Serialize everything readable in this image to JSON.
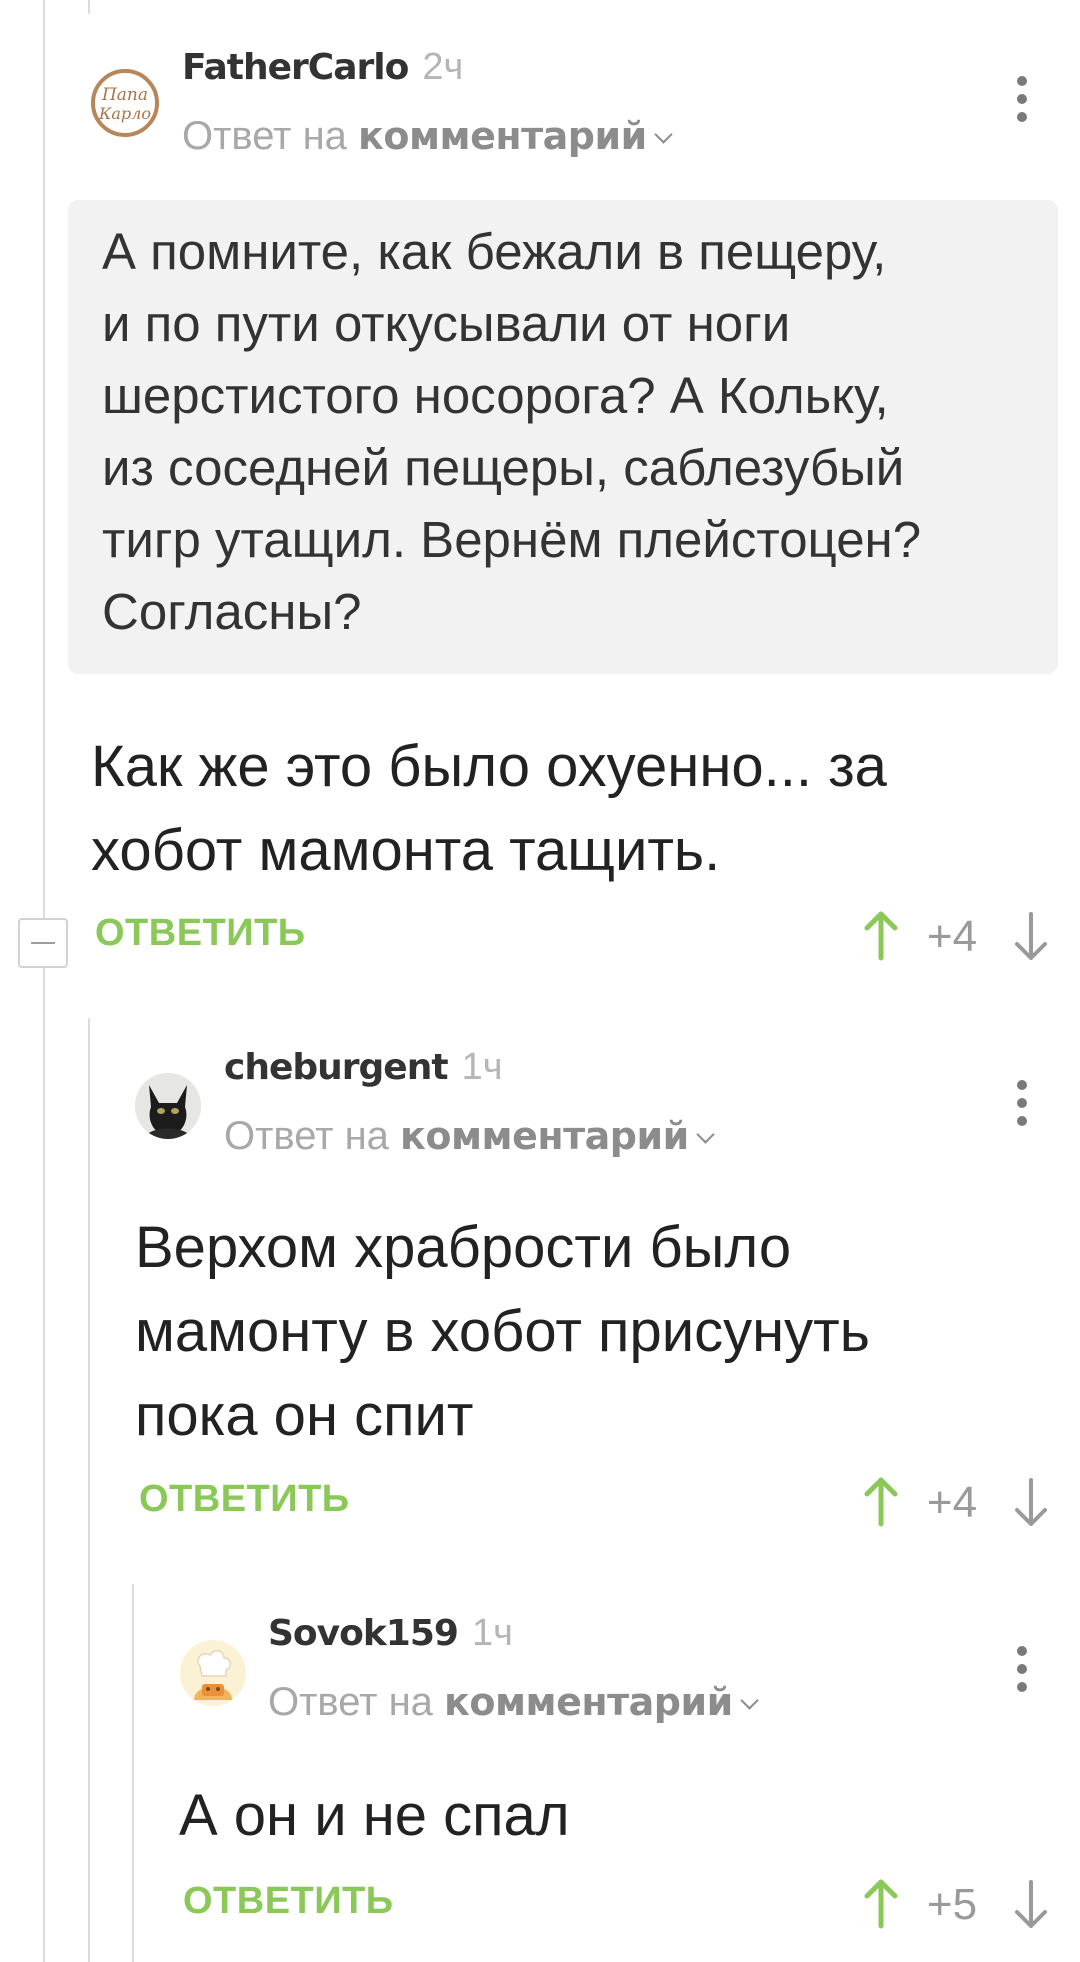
{
  "comments": [
    {
      "author": "FatherCarlo",
      "time": "2ч",
      "reply_prefix": "Ответ на",
      "reply_target": "комментарий",
      "avatar": "papa-karlo-stamp",
      "avatar_text_1": "Папа",
      "avatar_text_2": "Карло",
      "quote": "А помните, как бежали в пещеру,\nи по пути откусывали от ноги\nшерстистого носорога? А Кольку,\nиз соседней пещеры, саблезубый\nтигр утащил. Вернём плейстоцен?\nСогласны?",
      "text": "Как же это было охуенно... за\nхобот мамонта тащить.",
      "reply_label": "ОТВЕТИТЬ",
      "score": "+4"
    },
    {
      "author": "cheburgent",
      "time": "1ч",
      "reply_prefix": "Ответ на",
      "reply_target": "комментарий",
      "avatar": "black-cat-photo",
      "text": "Верхом храбрости было\nмамонту в хобот присунуть\nпока он спит",
      "reply_label": "ОТВЕТИТЬ",
      "score": "+4"
    },
    {
      "author": "Sovok159",
      "time": "1ч",
      "reply_prefix": "Ответ на",
      "reply_target": "комментарий",
      "avatar": "chef-cartoon",
      "text": "А он и не спал",
      "reply_label": "ОТВЕТИТЬ",
      "score": "+5"
    }
  ],
  "icons": {
    "more": "more-vertical-icon",
    "upvote": "arrow-up-icon",
    "downvote": "arrow-down-icon",
    "collapse": "minus-box-icon",
    "reply_chevron": "chevron-down-icon"
  },
  "colors": {
    "accent_green": "#8ac858",
    "quote_background": "#f2f2f2",
    "muted_text": "#a8a8a8"
  }
}
